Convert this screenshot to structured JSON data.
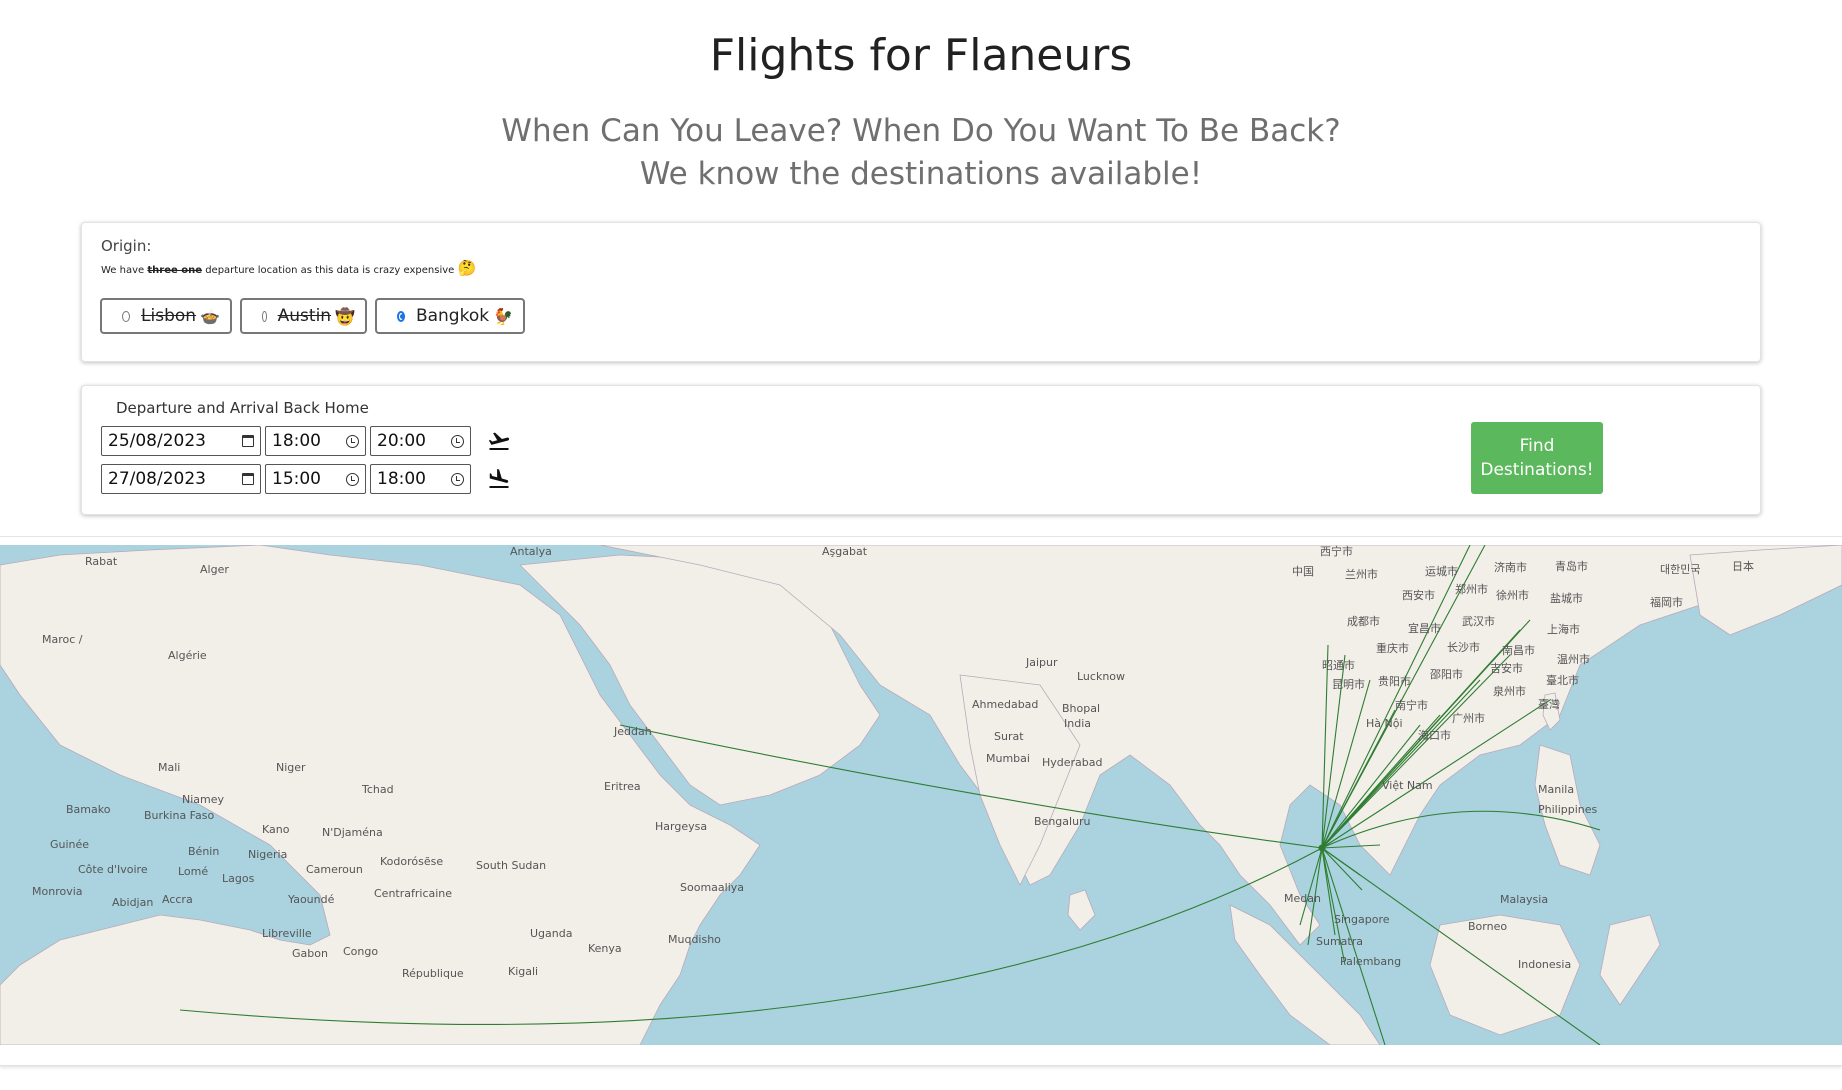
{
  "header": {
    "title": "Flights for Flaneurs",
    "subtitle_line1": "When Can You Leave? When Do You Want To Be Back?",
    "subtitle_line2": "We know the destinations available!"
  },
  "origin": {
    "label": "Origin:",
    "note_prefix": "We have",
    "note_struck": "three one",
    "note_suffix": "departure location as this data is crazy expensive",
    "note_emoji": "🤔",
    "options": [
      {
        "label": "Lisbon",
        "emoji": "🍲",
        "disabled": true,
        "selected": false
      },
      {
        "label": "Austin",
        "emoji": "🤠",
        "disabled": true,
        "selected": false
      },
      {
        "label": "Bangkok",
        "emoji": "🐓",
        "disabled": false,
        "selected": true
      }
    ]
  },
  "dates": {
    "label": "Departure and Arrival Back Home",
    "departure": {
      "date": "25/08/2023",
      "time_from": "18:00",
      "time_to": "20:00",
      "icon": "plane-takeoff-icon"
    },
    "return": {
      "date": "27/08/2023",
      "time_from": "15:00",
      "time_to": "18:00",
      "icon": "plane-landing-icon"
    },
    "button_label_1": "Find",
    "button_label_2": "Destinations!",
    "button_color": "#5cb85c"
  },
  "map": {
    "route_color": "#2e7d32",
    "water_color": "#aad3df",
    "land_color": "#f2efe9",
    "labels": [
      {
        "text": "Antalya"
      },
      {
        "text": "Aşgabat"
      },
      {
        "text": "西宁市"
      },
      {
        "text": "兰州市"
      },
      {
        "text": "中国"
      },
      {
        "text": "运城市"
      },
      {
        "text": "济南市"
      },
      {
        "text": "青岛市"
      },
      {
        "text": "대한민국"
      },
      {
        "text": "日本"
      },
      {
        "text": "Rabat"
      },
      {
        "text": "Alger"
      },
      {
        "text": "Maroc /"
      },
      {
        "text": "Algérie"
      },
      {
        "text": "Mali"
      },
      {
        "text": "Niger"
      },
      {
        "text": "Tchad"
      },
      {
        "text": "Niamey"
      },
      {
        "text": "Bamako"
      },
      {
        "text": "Burkina Faso"
      },
      {
        "text": "Guinée"
      },
      {
        "text": "Kano"
      },
      {
        "text": "N'Djaména"
      },
      {
        "text": "Bénin"
      },
      {
        "text": "Nigeria"
      },
      {
        "text": "Côte d'Ivoire"
      },
      {
        "text": "Lomé"
      },
      {
        "text": "Lagos"
      },
      {
        "text": "Monrovia"
      },
      {
        "text": "Abidjan"
      },
      {
        "text": "Accra"
      },
      {
        "text": "Yaoundé"
      },
      {
        "text": "Cameroun"
      },
      {
        "text": "Libreville"
      },
      {
        "text": "Gabon"
      },
      {
        "text": "Congo"
      },
      {
        "text": "République"
      },
      {
        "text": "Kodorósẽse"
      },
      {
        "text": "South Sudan"
      },
      {
        "text": "Centrafricaine"
      },
      {
        "text": "Uganda"
      },
      {
        "text": "Kenya"
      },
      {
        "text": "Kigali"
      },
      {
        "text": "Soomaaliya"
      },
      {
        "text": "Muqdisho"
      },
      {
        "text": "Hargeysa"
      },
      {
        "text": "Eritrea"
      },
      {
        "text": "Jeddah"
      },
      {
        "text": "Mumbai"
      },
      {
        "text": "Ahmedabad"
      },
      {
        "text": "Surat"
      },
      {
        "text": "Hyderabad"
      },
      {
        "text": "Bengaluru"
      },
      {
        "text": "Jaipur"
      },
      {
        "text": "Lucknow"
      },
      {
        "text": "Bhopal"
      },
      {
        "text": "India"
      },
      {
        "text": "Việt Nam"
      },
      {
        "text": "Hà Nội"
      },
      {
        "text": "Manila"
      },
      {
        "text": "Philippines"
      },
      {
        "text": "Medan"
      },
      {
        "text": "Singapore"
      },
      {
        "text": "Sumatra"
      },
      {
        "text": "Malaysia"
      },
      {
        "text": "Borneo"
      },
      {
        "text": "Palembang"
      },
      {
        "text": "Indonesia"
      },
      {
        "text": "成都市"
      },
      {
        "text": "重庆市"
      },
      {
        "text": "武汉市"
      },
      {
        "text": "长沙市"
      },
      {
        "text": "南昌市"
      },
      {
        "text": "上海市"
      },
      {
        "text": "温州市"
      },
      {
        "text": "昆明市"
      },
      {
        "text": "贵阳市"
      },
      {
        "text": "南宁市"
      },
      {
        "text": "广州市"
      },
      {
        "text": "海口市"
      },
      {
        "text": "泉州市"
      },
      {
        "text": "臺北市"
      },
      {
        "text": "臺灣"
      },
      {
        "text": "西安市"
      },
      {
        "text": "郑州市"
      },
      {
        "text": "徐州市"
      },
      {
        "text": "盐城市"
      },
      {
        "text": "福岡市"
      },
      {
        "text": "宜昌市"
      },
      {
        "text": "吉安市"
      },
      {
        "text": "邵阳市"
      },
      {
        "text": "昭通市"
      }
    ]
  }
}
